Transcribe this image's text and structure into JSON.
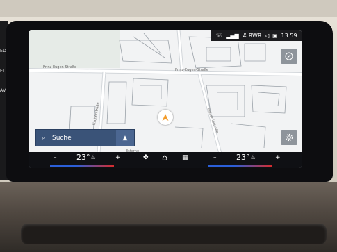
{
  "side_labels": [
    "EDIA",
    "EL",
    "AV"
  ],
  "status": {
    "network": "# RWR",
    "time": "13:59"
  },
  "streets": {
    "prinz_eugen_left": "Prinz-Eugen-Straße",
    "prinz_eugen_right": "Prinz-Eugen-Straße",
    "fischer_str": "Fischerstraße",
    "industrie_str": "Industriestraße",
    "bottom": "Esterne"
  },
  "search": {
    "label": "Suche"
  },
  "climate": {
    "left_temp": "23°",
    "right_temp": "23°",
    "minus": "–",
    "plus": "+"
  }
}
